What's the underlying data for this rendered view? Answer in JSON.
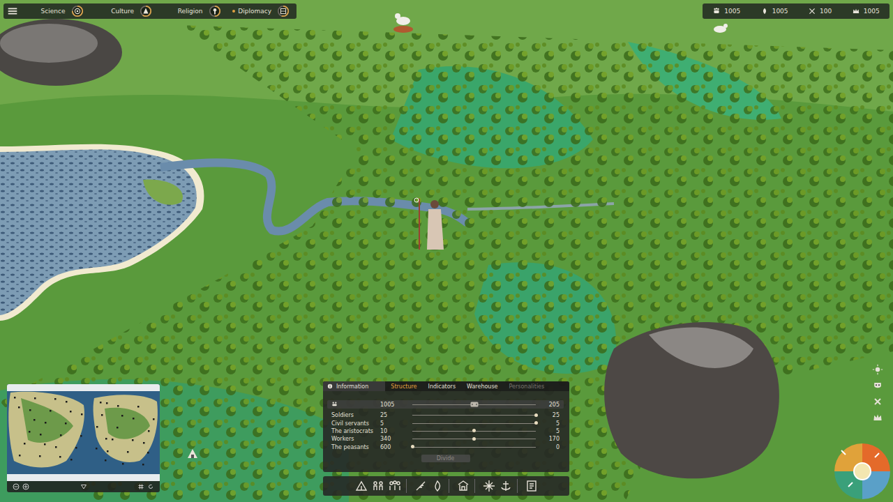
{
  "top_bar": {
    "tabs": [
      {
        "label": "Science",
        "level": 0.75,
        "notification": false
      },
      {
        "label": "Culture",
        "level": 0.6,
        "notification": false
      },
      {
        "label": "Religion",
        "level": 0.5,
        "notification": false
      },
      {
        "label": "Diplomacy",
        "level": 0.55,
        "notification": true
      }
    ]
  },
  "resources": [
    {
      "value": "1005"
    },
    {
      "value": "1005"
    },
    {
      "value": "100"
    },
    {
      "value": "1005"
    }
  ],
  "panel": {
    "title": "Information",
    "tabs": [
      {
        "label": "Structure",
        "selected": true,
        "disabled": false
      },
      {
        "label": "Indicators",
        "selected": false,
        "disabled": false
      },
      {
        "label": "Warehouse",
        "selected": false,
        "disabled": false
      },
      {
        "label": "Personalities",
        "selected": false,
        "disabled": true
      }
    ],
    "summary": {
      "total": "1005",
      "assigned": "205",
      "level": 0.5
    },
    "rows": [
      {
        "label": "Soldiers",
        "total": "25",
        "value": "25",
        "level": 1
      },
      {
        "label": "Civil servants",
        "total": "5",
        "value": "5",
        "level": 1
      },
      {
        "label": "The aristocrats",
        "total": "10",
        "value": "5",
        "level": 0.5
      },
      {
        "label": "Workers",
        "total": "340",
        "value": "170",
        "level": 0.5
      },
      {
        "label": "The peasants",
        "total": "600",
        "value": "0",
        "level": 0
      }
    ],
    "button": {
      "label": "Divide",
      "disabled": true
    }
  }
}
